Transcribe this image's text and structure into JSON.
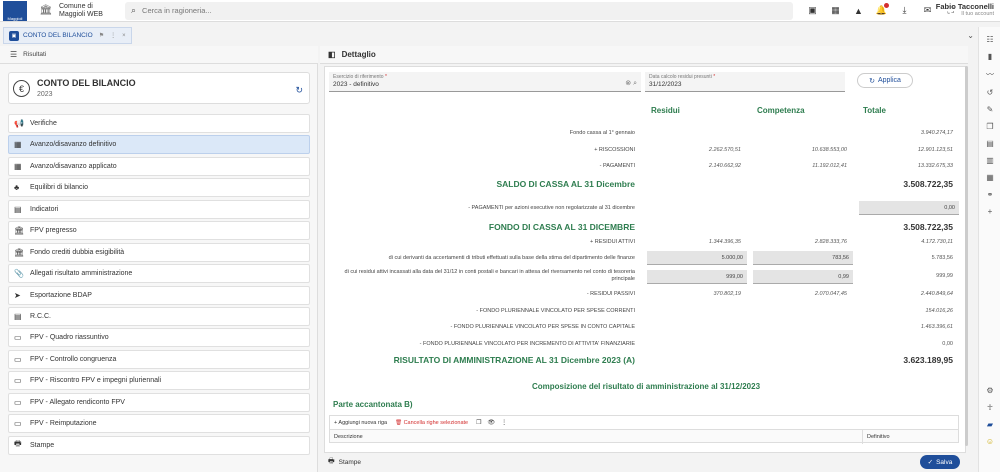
{
  "header": {
    "org_name": "Comune di Maggioli WEB",
    "search_placeholder": "Cerca in ragioneria...",
    "user_name": "Fabio Tacconelli",
    "user_sub": "Il tuo account"
  },
  "tab": {
    "label": "CONTO DEL BILANCIO"
  },
  "left": {
    "heading": "Risultati",
    "card_title": "CONTO DEL BILANCIO",
    "card_year": "2023",
    "menu": [
      {
        "label": "Verifiche",
        "icon": "megaphone-icon",
        "glyph": "📢"
      },
      {
        "label": "Avanzo/disavanzo definitivo",
        "icon": "grid-icon",
        "glyph": "▦"
      },
      {
        "label": "Avanzo/disavanzo applicato",
        "icon": "grid-icon",
        "glyph": "▦"
      },
      {
        "label": "Equilibri di bilancio",
        "icon": "shapes-icon",
        "glyph": "♣"
      },
      {
        "label": "Indicatori",
        "icon": "doc-icon",
        "glyph": "▤"
      },
      {
        "label": "FPV pregresso",
        "icon": "bank-icon",
        "glyph": "🏛"
      },
      {
        "label": "Fondo crediti dubbia esigibilità",
        "icon": "bank-icon",
        "glyph": "🏛"
      },
      {
        "label": "Allegati risultato amministrazione",
        "icon": "paperclip-icon",
        "glyph": "📎"
      },
      {
        "label": "Esportazione BDAP",
        "icon": "send-icon",
        "glyph": "➤"
      },
      {
        "label": "R.C.C.",
        "icon": "doc-icon",
        "glyph": "▤"
      },
      {
        "label": "FPV - Quadro riassuntivo",
        "icon": "card-icon",
        "glyph": "▭"
      },
      {
        "label": "FPV - Controllo congruenza",
        "icon": "card-icon",
        "glyph": "▭"
      },
      {
        "label": "FPV - Riscontro FPV e impegni pluriennali",
        "icon": "card-icon",
        "glyph": "▭"
      },
      {
        "label": "FPV - Allegato rendiconto FPV",
        "icon": "card-icon",
        "glyph": "▭"
      },
      {
        "label": "FPV - Reimputazione",
        "icon": "card-icon",
        "glyph": "▭"
      },
      {
        "label": "Stampe",
        "icon": "printer-icon",
        "glyph": "🖶"
      }
    ]
  },
  "detail": {
    "heading": "Dettaglio",
    "field1_label": "Esercizio di riferimento",
    "field1_value": "2023 - definitivo",
    "field2_label": "Data calcolo residui presunti",
    "field2_value": "31/12/2023",
    "applica": "Applica",
    "col_residui": "Residui",
    "col_competenza": "Competenza",
    "col_totale": "Totale",
    "rows": {
      "fondo_cassa_label": "Fondo cassa al 1° gennaio",
      "fondo_cassa_tot": "3.940.274,17",
      "riscossioni_label": "+ RISCOSSIONI",
      "riscossioni_res": "2.262.570,51",
      "riscossioni_comp": "10.638.553,00",
      "riscossioni_tot": "12.901.123,51",
      "pagamenti_label": "- PAGAMENTI",
      "pagamenti_res": "2.140.662,92",
      "pagamenti_comp": "11.192.012,41",
      "pagamenti_tot": "13.332.675,33",
      "saldo_label": "SALDO DI CASSA AL 31 Dicembre",
      "saldo_tot": "3.508.722,35",
      "pag_azioni_label": "- PAGAMENTI per azioni esecutive non regolarizzate al 31 dicembre",
      "pag_azioni_tot": "0,00",
      "fondo_31_label": "FONDO DI CASSA AL 31 DICEMBRE",
      "fondo_31_tot": "3.508.722,35",
      "res_attivi_label": "+ RESIDUI ATTIVI",
      "res_attivi_res": "1.344.396,35",
      "res_attivi_comp": "2.828.333,76",
      "res_attivi_tot": "4.172.730,11",
      "derivanti_label": "di cui derivanti da accertamenti di tributi effettuati sulla base della stima del dipartimento delle finanze",
      "derivanti_res": "5.000,00",
      "derivanti_comp": "783,56",
      "derivanti_tot": "5.783,56",
      "incassati_label": "di cui residui attivi incassati alla data del 31/12 in conti postali e bancari in attesa del riversamento nel conto di tesoreria principale",
      "incassati_res": "999,00",
      "incassati_comp": "0,99",
      "incassati_tot": "999,99",
      "res_passivi_label": "- RESIDUI PASSIVI",
      "res_passivi_res": "370.802,19",
      "res_passivi_comp": "2.070.047,45",
      "res_passivi_tot": "2.440.849,64",
      "fpv_correnti_label": "- FONDO PLURIENNALE VINCOLATO PER SPESE CORRENTI",
      "fpv_correnti_tot": "154.016,26",
      "fpv_capitale_label": "- FONDO PLURIENNALE VINCOLATO PER SPESE IN CONTO CAPITALE",
      "fpv_capitale_tot": "1.463.396,61",
      "fpv_finanz_label": "- FONDO PLURIENNALE VINCOLATO PER INCREMENTO DI ATTIVITA' FINANZIARIE",
      "fpv_finanz_tot": "0,00",
      "risultato_label": "RISULTATO DI AMMINISTRAZIONE AL 31 Dicembre 2023 (A)",
      "risultato_tot": "3.623.189,95"
    },
    "composizione_title": "Composizione del risultato di amministrazione al 31/12/2023",
    "parte_title": "Parte accantonata B)",
    "grid_add": "+ Aggiungi nuova riga",
    "grid_delete": "Cancella righe selezionate",
    "grid_col_desc": "Descrizione",
    "grid_col_def": "Definitivo"
  },
  "footer": {
    "stampe": "Stampe",
    "salva": "Salva"
  }
}
